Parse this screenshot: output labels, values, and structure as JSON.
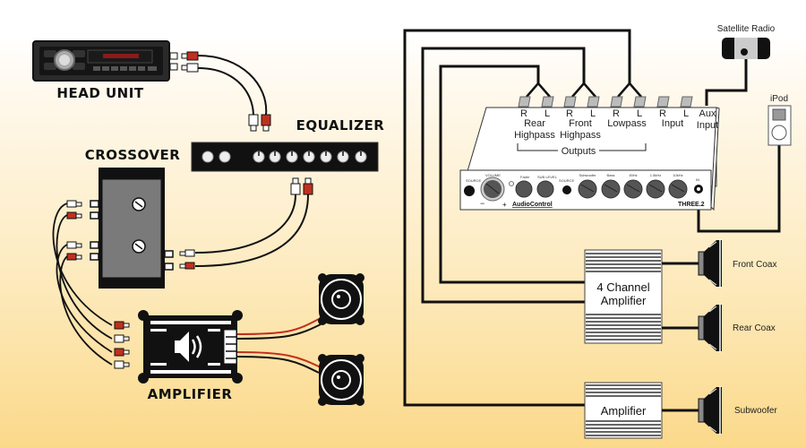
{
  "left_diagram": {
    "head_unit": {
      "label": "HEAD UNIT"
    },
    "equalizer": {
      "label": "EQUALIZER",
      "knob_count": 9
    },
    "crossover": {
      "label": "CROSSOVER"
    },
    "amplifier": {
      "label": "AMPLIFIER"
    },
    "colors": {
      "rca_red": "#c0301e",
      "rca_white": "#ffffff",
      "device": "#111111",
      "crossover_body": "#7a7a7a"
    }
  },
  "right_diagram": {
    "processor": {
      "brand": "AudioControl",
      "model": "THREE.2",
      "ports": [
        {
          "channel": "R",
          "group": "Rear Highpass"
        },
        {
          "channel": "L",
          "group": "Rear Highpass"
        },
        {
          "channel": "R",
          "group": "Front Highpass"
        },
        {
          "channel": "L",
          "group": "Front Highpass"
        },
        {
          "channel": "R",
          "group": "Lowpass"
        },
        {
          "channel": "L",
          "group": "Lowpass"
        },
        {
          "channel": "R",
          "group": "Input"
        },
        {
          "channel": "L",
          "group": "Input"
        }
      ],
      "group_labels": {
        "rear_l1": "Rear",
        "rear_l2": "Highpass",
        "front_l1": "Front",
        "front_l2": "Highpass",
        "lowpass": "Lowpass",
        "input": "Input",
        "aux_l1": "Aux",
        "aux_l2": "Input",
        "outputs": "Outputs"
      },
      "panel_labels": {
        "source": "SOURCE",
        "volume": "VOLUME",
        "fader": "Fader",
        "sub_level": "SUB LEVEL",
        "aux_select": "SOURCE",
        "bass_group": "Bass",
        "knob_titles": [
          "Subwoofer",
          "Bass",
          "45Hz",
          "1.5kHz",
          "10kHz"
        ],
        "in": "IN"
      }
    },
    "satellite_radio": {
      "label": "Satellite Radio"
    },
    "ipod": {
      "label": "iPod"
    },
    "four_channel_amp": {
      "line1": "4 Channel",
      "line2": "Amplifier"
    },
    "sub_amp": {
      "label": "Amplifier"
    },
    "speakers": [
      {
        "label": "Front Coax"
      },
      {
        "label": "Rear Coax"
      },
      {
        "label": "Subwoofer"
      }
    ]
  }
}
